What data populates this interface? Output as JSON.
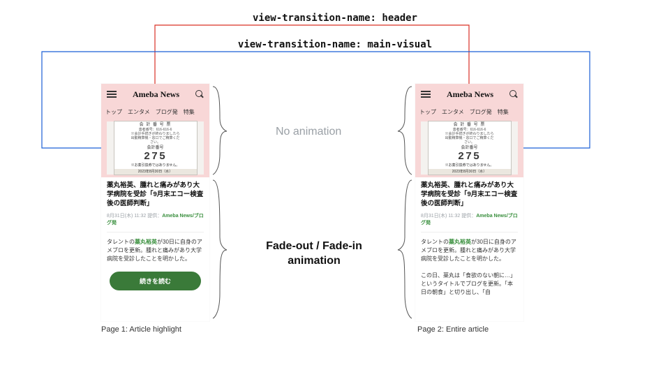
{
  "annotations": {
    "header_label": "view-transition-name: header",
    "visual_label": "view-transition-name: main-visual",
    "no_animation": "No animation",
    "fade_line1": "Fade-out / Fade-in",
    "fade_line2": "animation"
  },
  "captions": {
    "page1": "Page 1: Article highlight",
    "page2": "Page 2: Entire article"
  },
  "phone": {
    "logo": "Ameba News",
    "tabs": [
      "トップ",
      "エンタメ",
      "ブログ発",
      "特集"
    ],
    "ticket": {
      "title": "会 計 番 号 票",
      "sub1": "患者番号：616-616-6",
      "sub2": "※会計手続きが終わりましたら\n出動精算機・窓口でご精算くだ\nさい。",
      "num_label": "会計番号",
      "num": "275",
      "note": "※お薬引換券ではありません。",
      "date": "2023年8月30日（水）"
    },
    "headline": "薬丸裕英、腫れと痛みがあり大学病院を受診「9月末エコー検査後の医師判断」",
    "meta_date": "8月31日(木) 11:32",
    "meta_provider_label": "提供：",
    "meta_provider": "Ameba News/ブログ発",
    "body_pre": "タレントの",
    "body_link": "薬丸裕英",
    "body_post": "が30日に自身のアメブロを更新。腫れと痛みがあり大学病院を受診したことを明かした。",
    "body2": "この日、薬丸は「食欲のない朝に…」というタイトルでブログを更新。「本日の朝食」と切り出し、「自",
    "button": "続きを読む"
  }
}
